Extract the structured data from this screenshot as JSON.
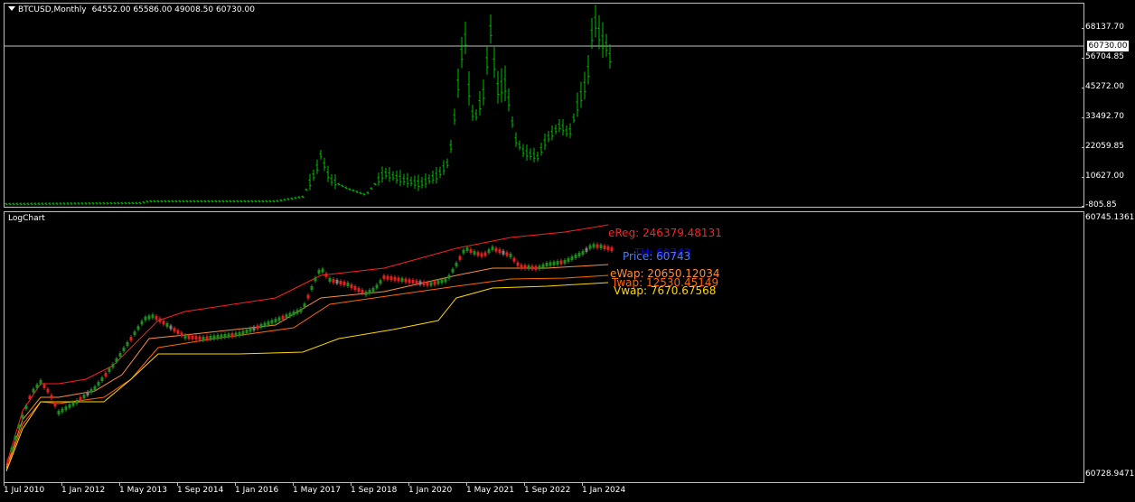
{
  "top_pane": {
    "symbol_label": "BTCUSD,Monthly",
    "ohlc": "64552.00 65586.00 49008.50 60730.00",
    "price_ticks": [
      "68137.70",
      "56704.85",
      "45272.00",
      "33492.70",
      "22059.85",
      "10627.00",
      "-805.85"
    ],
    "current_price": "60730.00",
    "bar_color": "#00c000",
    "grid_line_color": "#c0c0c0"
  },
  "bottom_pane": {
    "indicator_name": "LogChart",
    "scale_top": "60745.1361",
    "scale_bottom": "60728.9471",
    "colors": {
      "up": "#1e8c1e",
      "down": "#e02020",
      "neutral": "#808080",
      "ereg": "#ff2020",
      "ewap": "#ff8c3c",
      "twap": "#ff6600",
      "vwap": "#ffd700",
      "price": "#4a78ff",
      "th": "#0000ff"
    },
    "labels": {
      "ereg": "eReg: 246379.48131",
      "th": "TH: 60743",
      "price": "Price: 60743",
      "ewap": "eWap: 20650.12034",
      "twap": "Twap: 12530.45149",
      "vwap": "Vwap: 7670.67568"
    }
  },
  "time_axis": [
    "1 Jul 2010",
    "1 Jan 2012",
    "1 May 2013",
    "1 Sep 2014",
    "1 Jan 2016",
    "1 May 2017",
    "1 Sep 2018",
    "1 Jan 2020",
    "1 May 2021",
    "1 Sep 2022",
    "1 Jan 2024"
  ]
}
